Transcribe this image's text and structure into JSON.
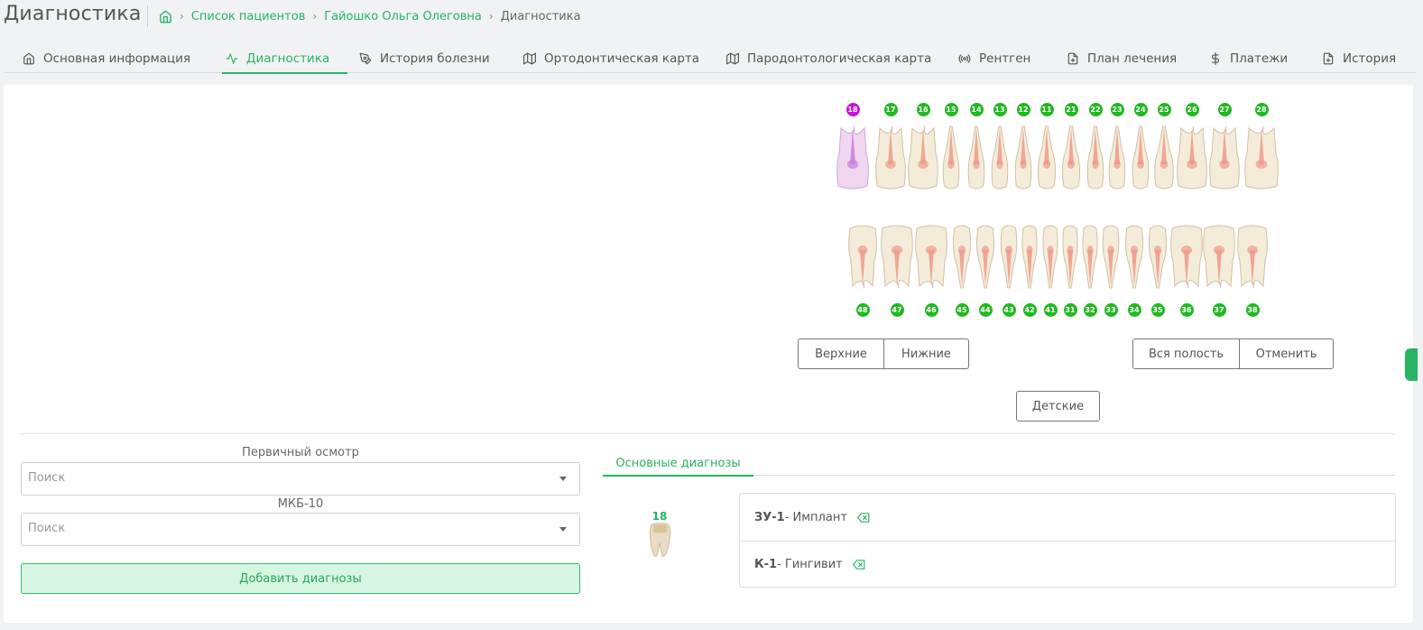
{
  "page": {
    "title": "Диагностика"
  },
  "breadcrumb": {
    "items": [
      "Список пациентов",
      "Гайошко Ольга Олеговна"
    ],
    "current": "Диагностика"
  },
  "tabs": [
    {
      "label": "Основная информация",
      "icon": "home-icon"
    },
    {
      "label": "Диагностика",
      "icon": "activity-icon"
    },
    {
      "label": "История болезни",
      "icon": "pen-tool-icon"
    },
    {
      "label": "Ортодонтическая карта",
      "icon": "map-icon"
    },
    {
      "label": "Пародонтологическая карта",
      "icon": "map-icon"
    },
    {
      "label": "Рентген",
      "icon": "radio-icon"
    },
    {
      "label": "План лечения",
      "icon": "file-plus-icon"
    },
    {
      "label": "Платежи",
      "icon": "dollar-icon"
    },
    {
      "label": "История",
      "icon": "file-plus-icon"
    }
  ],
  "teeth": {
    "upper": [
      "18",
      "17",
      "16",
      "15",
      "14",
      "13",
      "12",
      "11",
      "21",
      "22",
      "23",
      "24",
      "25",
      "26",
      "27",
      "28"
    ],
    "lower": [
      "48",
      "47",
      "46",
      "45",
      "44",
      "43",
      "42",
      "41",
      "31",
      "32",
      "33",
      "34",
      "35",
      "36",
      "37",
      "38"
    ],
    "selected": "18",
    "selected_color": "#cc11dd",
    "number_color": "#22b822"
  },
  "jaw_buttons": {
    "upper": "Верхние",
    "lower": "Нижние",
    "all": "Вся полость",
    "cancel": "Отменить",
    "kids": "Детские"
  },
  "form": {
    "primary_label": "Первичный осмотр",
    "primary_placeholder": "Поиск",
    "icd_label": "МКБ-10",
    "icd_placeholder": "Поиск",
    "add_button": "Добавить диагнозы"
  },
  "diagnoses": {
    "tab": "Основные диагнозы",
    "tooth": "18",
    "items": [
      {
        "code": "ЗУ-1",
        "text": " - Имплант"
      },
      {
        "code": "К-1",
        "text": " - Гингивит"
      }
    ]
  },
  "colors": {
    "accent": "#28b463"
  }
}
